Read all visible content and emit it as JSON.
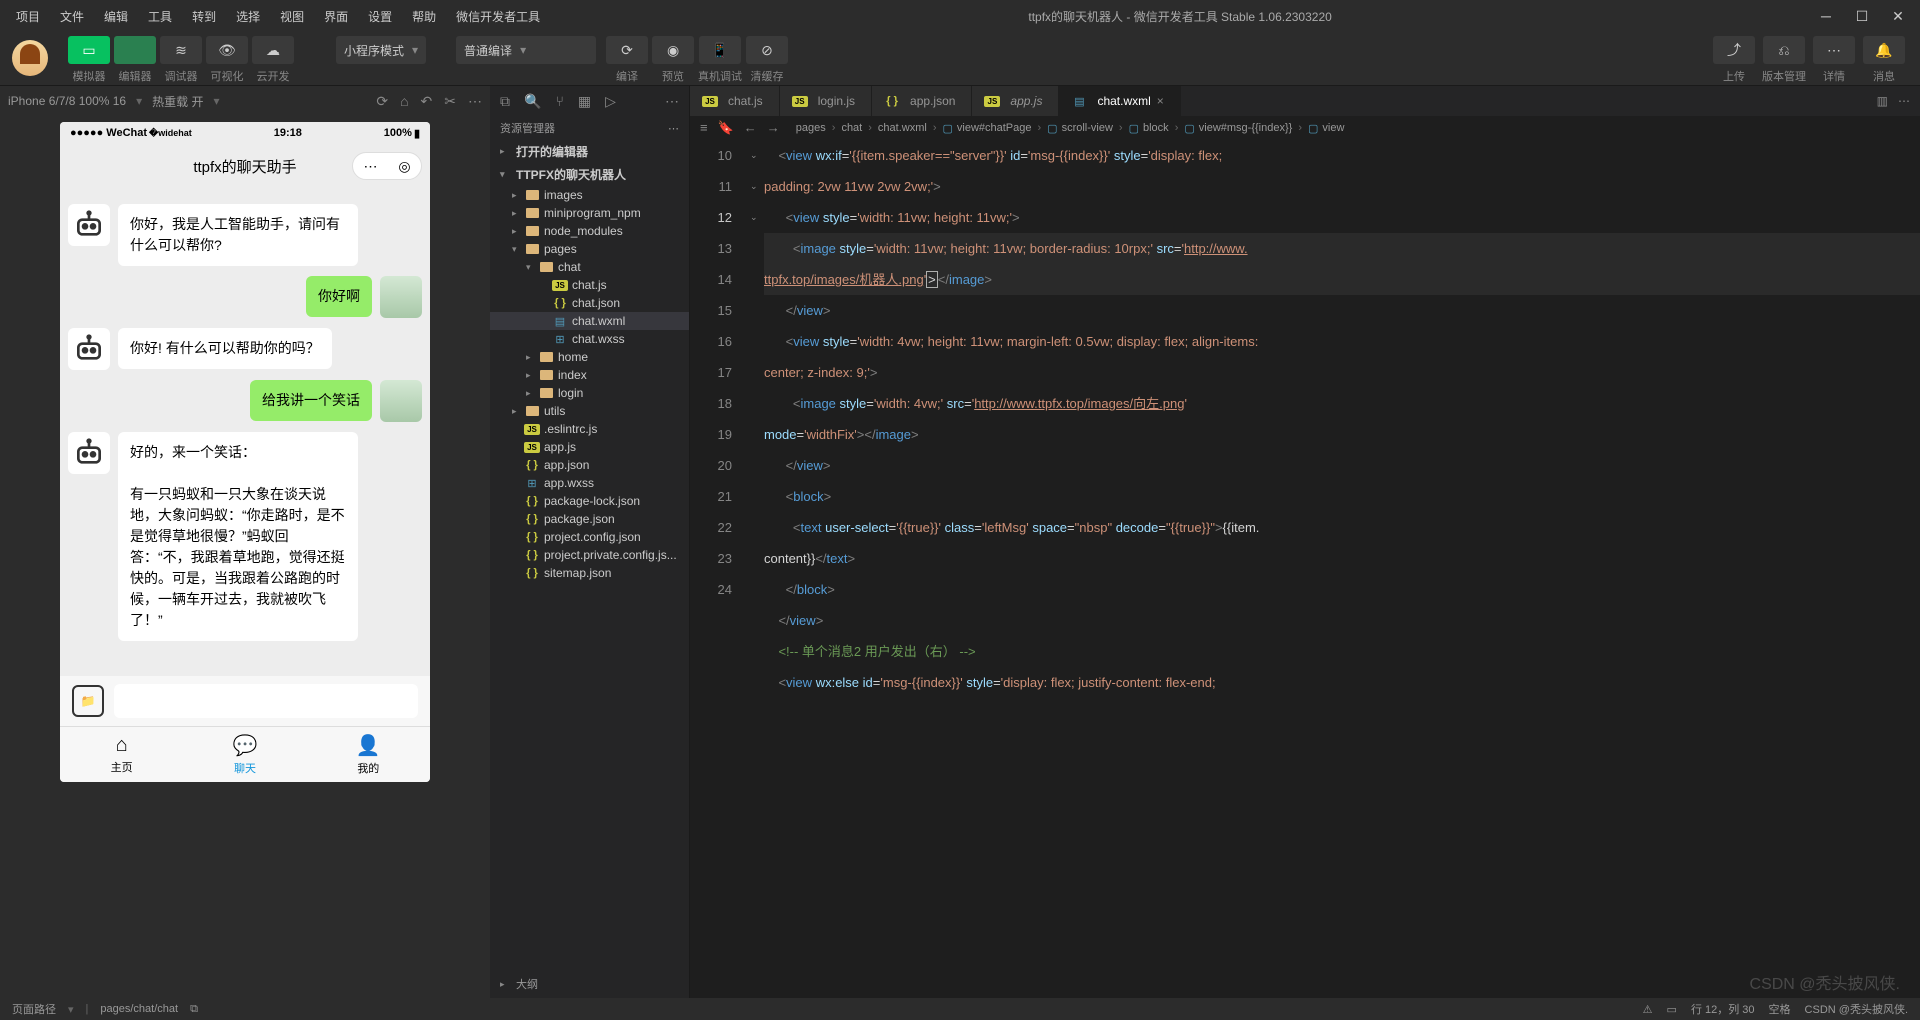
{
  "menubar": [
    "项目",
    "文件",
    "编辑",
    "工具",
    "转到",
    "选择",
    "视图",
    "界面",
    "设置",
    "帮助",
    "微信开发者工具"
  ],
  "window_title": "ttpfx的聊天机器人 - 微信开发者工具 Stable 1.06.2303220",
  "toolbar": {
    "groups": [
      {
        "icon": "▭",
        "label": "模拟器",
        "cls": "green"
      },
      {
        "icon": "</>",
        "label": "编辑器",
        "cls": "green2"
      },
      {
        "icon": "≋",
        "label": "调试器",
        "cls": ""
      },
      {
        "icon": "👁",
        "label": "可视化",
        "cls": ""
      },
      {
        "icon": "☁",
        "label": "云开发",
        "cls": ""
      }
    ],
    "mode": "小程序模式",
    "compile": "普通编译",
    "actions": [
      {
        "icon": "⟳",
        "label": "编译"
      },
      {
        "icon": "◉",
        "label": "预览"
      },
      {
        "icon": "📱",
        "label": "真机调试"
      },
      {
        "icon": "⊘",
        "label": "清缓存"
      }
    ],
    "right": [
      {
        "icon": "⤴",
        "label": "上传"
      },
      {
        "icon": "⎌",
        "label": "版本管理"
      },
      {
        "icon": "⋯",
        "label": "详情"
      },
      {
        "icon": "🔔",
        "label": "消息"
      }
    ]
  },
  "sim": {
    "device": "iPhone 6/7/8 100% 16",
    "hot": "热重载 开",
    "status_left": "●●●●● WeChat",
    "status_time": "19:18",
    "status_batt": "100%",
    "nav_title": "ttpfx的聊天助手",
    "messages": [
      {
        "side": "left",
        "text": "你好，我是人工智能助手，请问有什么可以帮你?"
      },
      {
        "side": "right",
        "text": "你好啊"
      },
      {
        "side": "left",
        "text": "你好! 有什么可以帮助你的吗？"
      },
      {
        "side": "right",
        "text": "给我讲一个笑话"
      },
      {
        "side": "left",
        "text": "好的，来一个笑话：\n\n有一只蚂蚁和一只大象在谈天说地，大象问蚂蚁：“你走路时，是不是觉得草地很慢？”蚂蚁回答：“不，我跟着草地跑，觉得还挺快的。可是，当我跟着公路跑的时候，一辆车开过去，我就被吹飞了！”"
      }
    ],
    "tabs": [
      {
        "icon": "⌂",
        "label": "主页"
      },
      {
        "icon": "💬",
        "label": "聊天",
        "active": true
      },
      {
        "icon": "👤",
        "label": "我的"
      }
    ]
  },
  "explorer": {
    "title": "资源管理器",
    "open_editors": "打开的编辑器",
    "project": "TTPFX的聊天机器人",
    "tree": [
      {
        "d": 1,
        "exp": true,
        "icon": "folder",
        "name": "images",
        "chev": "▸"
      },
      {
        "d": 1,
        "exp": false,
        "icon": "folder",
        "name": "miniprogram_npm",
        "chev": "▸"
      },
      {
        "d": 1,
        "exp": false,
        "icon": "folder",
        "name": "node_modules",
        "chev": "▸"
      },
      {
        "d": 1,
        "exp": true,
        "icon": "folder",
        "name": "pages",
        "chev": "▾"
      },
      {
        "d": 2,
        "exp": true,
        "icon": "folder",
        "name": "chat",
        "chev": "▾"
      },
      {
        "d": 3,
        "icon": "js",
        "name": "chat.js"
      },
      {
        "d": 3,
        "icon": "json",
        "name": "chat.json"
      },
      {
        "d": 3,
        "icon": "wxml",
        "name": "chat.wxml",
        "sel": true
      },
      {
        "d": 3,
        "icon": "wxss",
        "name": "chat.wxss"
      },
      {
        "d": 2,
        "icon": "folder",
        "name": "home",
        "chev": "▸"
      },
      {
        "d": 2,
        "icon": "folder",
        "name": "index",
        "chev": "▸"
      },
      {
        "d": 2,
        "icon": "folder",
        "name": "login",
        "chev": "▸"
      },
      {
        "d": 1,
        "icon": "folder",
        "name": "utils",
        "chev": "▸"
      },
      {
        "d": 1,
        "icon": "js",
        "name": ".eslintrc.js"
      },
      {
        "d": 1,
        "icon": "js",
        "name": "app.js"
      },
      {
        "d": 1,
        "icon": "json",
        "name": "app.json"
      },
      {
        "d": 1,
        "icon": "wxss",
        "name": "app.wxss"
      },
      {
        "d": 1,
        "icon": "json",
        "name": "package-lock.json"
      },
      {
        "d": 1,
        "icon": "json",
        "name": "package.json"
      },
      {
        "d": 1,
        "icon": "json",
        "name": "project.config.json"
      },
      {
        "d": 1,
        "icon": "json",
        "name": "project.private.config.js..."
      },
      {
        "d": 1,
        "icon": "json",
        "name": "sitemap.json"
      }
    ],
    "outline": "大纲"
  },
  "editor": {
    "tabs": [
      {
        "icon": "js",
        "name": "chat.js"
      },
      {
        "icon": "js",
        "name": "login.js"
      },
      {
        "icon": "json",
        "name": "app.json"
      },
      {
        "icon": "js",
        "name": "app.js",
        "italic": true
      },
      {
        "icon": "wxml",
        "name": "chat.wxml",
        "active": true
      }
    ],
    "breadcrumb": [
      "pages",
      "chat",
      "chat.wxml",
      "view#chatPage",
      "scroll-view",
      "block",
      "view#msg-{{index}}",
      "view"
    ],
    "gutter": [
      "10",
      "",
      "11",
      "12",
      "",
      "13",
      "",
      "14",
      "",
      "15",
      "",
      "16",
      "17",
      "18",
      "",
      "19",
      "20",
      "21",
      "22",
      "23",
      "24"
    ],
    "fold": {
      "1": "⌄",
      "3": "⌄",
      "8": "⌄"
    }
  },
  "status": {
    "left": [
      "页面路径",
      "pages/chat/chat"
    ],
    "right": [
      "行 12，列 30",
      "空格",
      "CSDN @秃头披风侠."
    ]
  },
  "watermark": "CSDN @秃头披风侠."
}
